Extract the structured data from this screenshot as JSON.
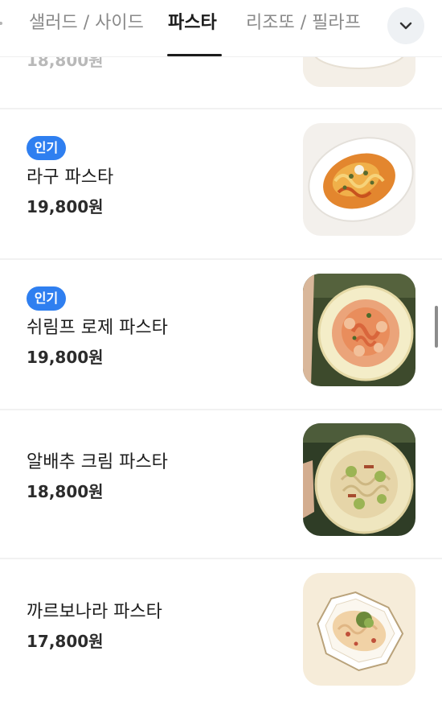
{
  "tabs": [
    {
      "label": "샐러드 / 사이드",
      "active": false
    },
    {
      "label": "파스타",
      "active": true
    },
    {
      "label": "리조또 / 필라프",
      "active": false
    }
  ],
  "more_icon": "chevron-down-icon",
  "menu": {
    "partial_item": {
      "price": "18,800원"
    },
    "items": [
      {
        "badge": "인기",
        "name": "라구 파스타",
        "price": "19,800원"
      },
      {
        "badge": "인기",
        "name": "쉬림프 로제 파스타",
        "price": "19,800원"
      },
      {
        "badge": "",
        "name": "알배추 크림 파스타",
        "price": "18,800원"
      },
      {
        "badge": "",
        "name": "까르보나라 파스타",
        "price": "17,800원"
      }
    ]
  },
  "colors": {
    "badge": "#2f7ff0",
    "active_tab": "#1c1c1c",
    "inactive_tab": "#8a8a8a"
  }
}
